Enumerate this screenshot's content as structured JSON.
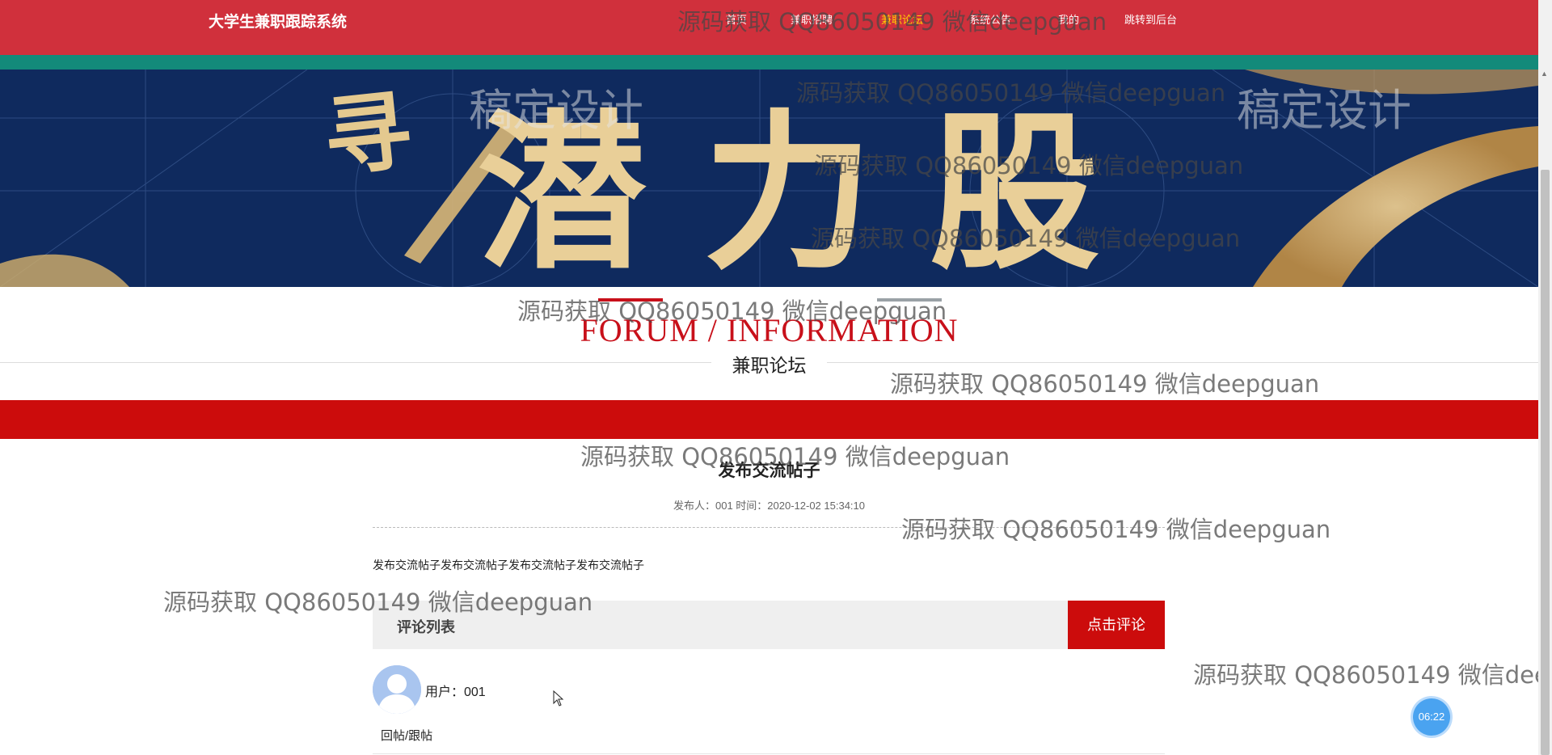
{
  "site": {
    "title": "大学生兼职跟踪系统"
  },
  "nav": {
    "items": [
      {
        "label": "首页",
        "active": false
      },
      {
        "label": "兼职招聘",
        "active": false
      },
      {
        "label": "兼职论坛",
        "active": true
      },
      {
        "label": "系统公告",
        "active": false
      },
      {
        "label": "我的",
        "active": false
      },
      {
        "label": "跳转到后台",
        "active": false
      }
    ]
  },
  "banner": {
    "calligraphy": "潜力股",
    "brush_char": "寻",
    "stamp_text": "稿定设计"
  },
  "section": {
    "title_en": "FORUM / INFORMATION",
    "title_cn": "兼职论坛"
  },
  "post": {
    "title": "发布交流帖子",
    "meta": "发布人：001 时间：2020-12-02 15:34:10",
    "content": "发布交流帖子发布交流帖子发布交流帖子发布交流帖子"
  },
  "comments": {
    "header": "评论列表",
    "button_label": "点击评论",
    "items": [
      {
        "user": "用户：001",
        "text": "回帖/跟帖"
      }
    ]
  },
  "clock": {
    "time": "06:22"
  },
  "watermark": {
    "text": "源码获取 QQ86050149 微信deepguan"
  },
  "colors": {
    "header_red": "#d0303c",
    "teal_stripe": "#138a7a",
    "accent_red": "#cc0c0c",
    "active_nav": "#ffd200"
  }
}
